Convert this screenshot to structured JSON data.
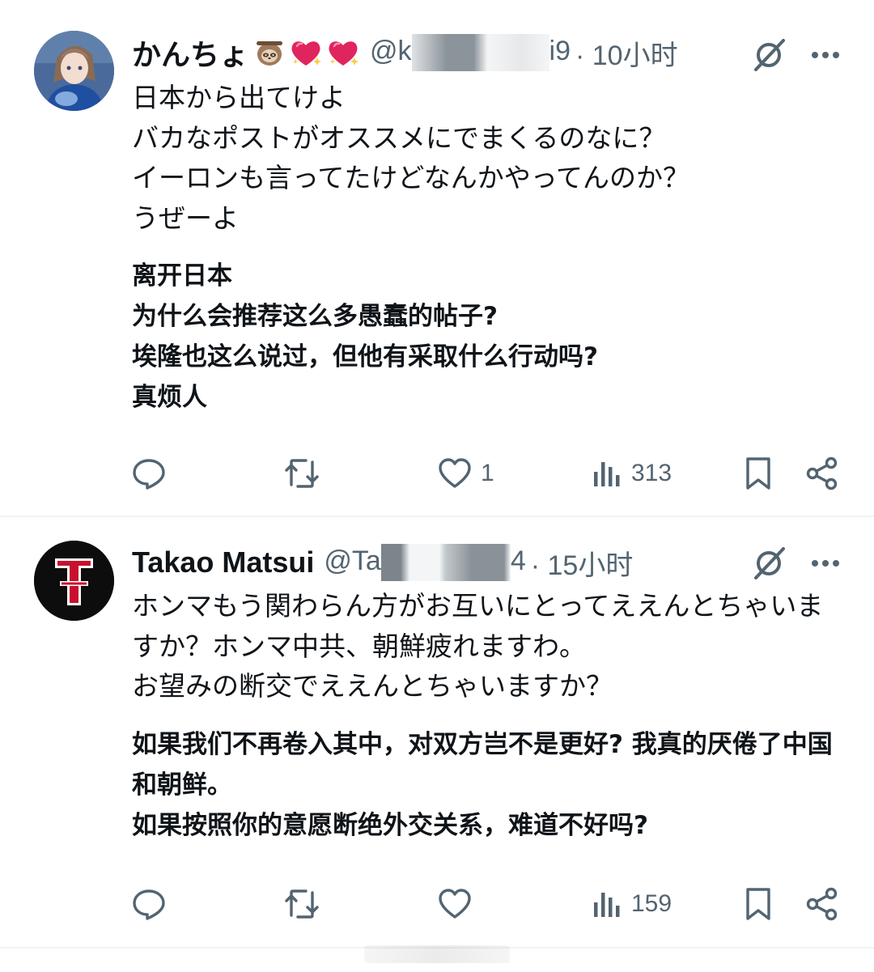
{
  "tweets": [
    {
      "author": "かんちょ",
      "emojis": [
        "sloth-emoji",
        "sparkling-heart-emoji",
        "sparkling-heart-emoji"
      ],
      "handle_prefix": "@k",
      "handle_suffix": "i9",
      "time": "· 10小时",
      "text_jp": "日本から出てけよ\nバカなポストがオススメにでまくるのなに？\nイーロンも言ってたけどなんかやってんのか？\nうぜーよ",
      "text_cn": "离开日本\n为什么会推荐这么多愚蠢的帖子?\n埃隆也这么说过，但他有采取什么行动吗?\n真烦人",
      "likes": "1",
      "views": "313"
    },
    {
      "author": "Takao Matsui",
      "handle_prefix": "@Ta",
      "handle_suffix": "4",
      "time": "· 15小时",
      "text_jp": "ホンマもう関わらん方がお互いにとってええんとちゃいますか？ホンマ中共、朝鮮疲れますわ。\nお望みの断交でええんとちゃいますか？",
      "text_cn": "如果我们不再卷入其中，对双方岂不是更好? 我真的厌倦了中国和朝鲜。\n如果按照你的意愿断绝外交关系，难道不好吗?",
      "likes": "",
      "views": "159"
    }
  ],
  "colors": {
    "text": "#0f1419",
    "secondary": "#536471",
    "divider": "#eff3f4",
    "heart": "#e0245e"
  }
}
